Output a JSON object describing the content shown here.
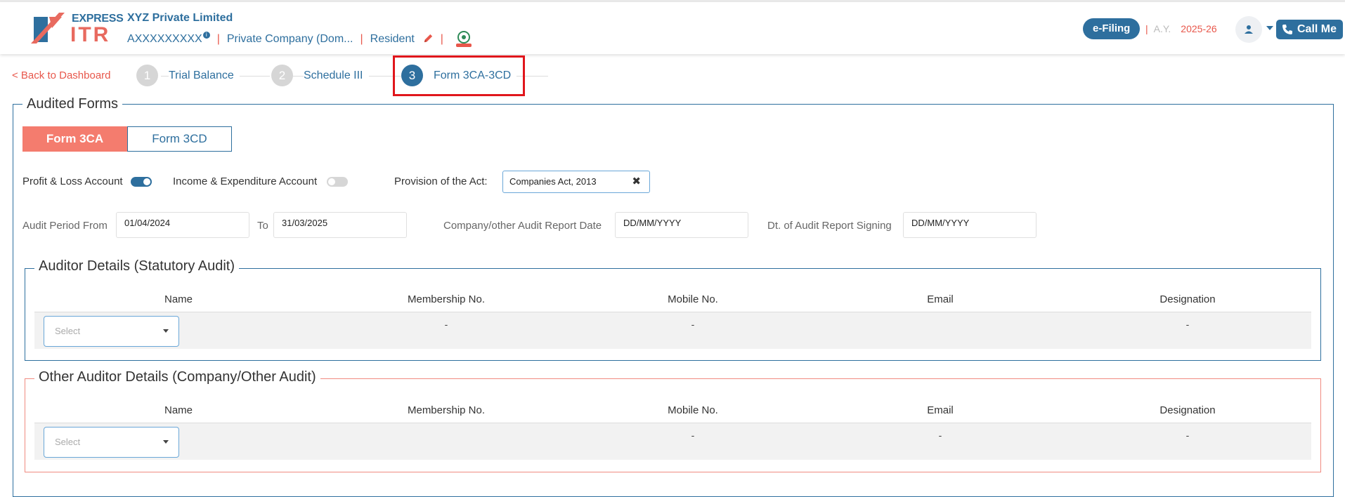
{
  "header": {
    "logo_top": "EXPRESS",
    "logo_bottom": "ITR",
    "company_name": "XYZ Private Limited",
    "pan": "AXXXXXXXXX",
    "pan_info": "i",
    "company_type": "Private Company (Dom...",
    "residency": "Resident",
    "efiling_label": "e-Filing",
    "ay_label": "A.Y.",
    "ay_value": "2025-26",
    "call_label": "Call Me"
  },
  "stepper": {
    "back_label": "< Back to Dashboard",
    "steps": [
      {
        "number": "1",
        "label": "Trial Balance"
      },
      {
        "number": "2",
        "label": "Schedule III"
      },
      {
        "number": "3",
        "label": "Form 3CA-3CD"
      }
    ]
  },
  "audited_forms": {
    "title": "Audited Forms",
    "tabs": [
      "Form 3CA",
      "Form 3CD"
    ],
    "pl_label": "Profit & Loss Account",
    "ie_label": "Income & Expenditure Account",
    "provision_label": "Provision of the Act:",
    "provision_value": "Companies Act, 2013",
    "period_from_label": "Audit Period From",
    "period_from_value": "01/04/2024",
    "to_label": "To",
    "period_to_value": "31/03/2025",
    "company_report_label": "Company/other Audit Report Date",
    "company_report_value": "DD/MM/YYYY",
    "signing_label": "Dt. of Audit Report Signing",
    "signing_value": "DD/MM/YYYY"
  },
  "auditor": {
    "title": "Auditor Details (Statutory Audit)",
    "columns": [
      "Name",
      "Membership No.",
      "Mobile No.",
      "Email",
      "Designation"
    ],
    "select_placeholder": "Select",
    "row": {
      "membership": "-",
      "mobile": "-",
      "designation": "-"
    }
  },
  "other_auditor": {
    "title": "Other Auditor Details (Company/Other Audit)",
    "columns": [
      "Name",
      "Membership No.",
      "Mobile No.",
      "Email",
      "Designation"
    ],
    "select_placeholder": "Select",
    "row": {
      "mobile": "-",
      "email": "-",
      "designation": "-"
    }
  },
  "colors": {
    "primary": "#2e6f9e",
    "accent": "#e8574b",
    "tab_active": "#f47c6e",
    "highlight": "#e0161c"
  }
}
